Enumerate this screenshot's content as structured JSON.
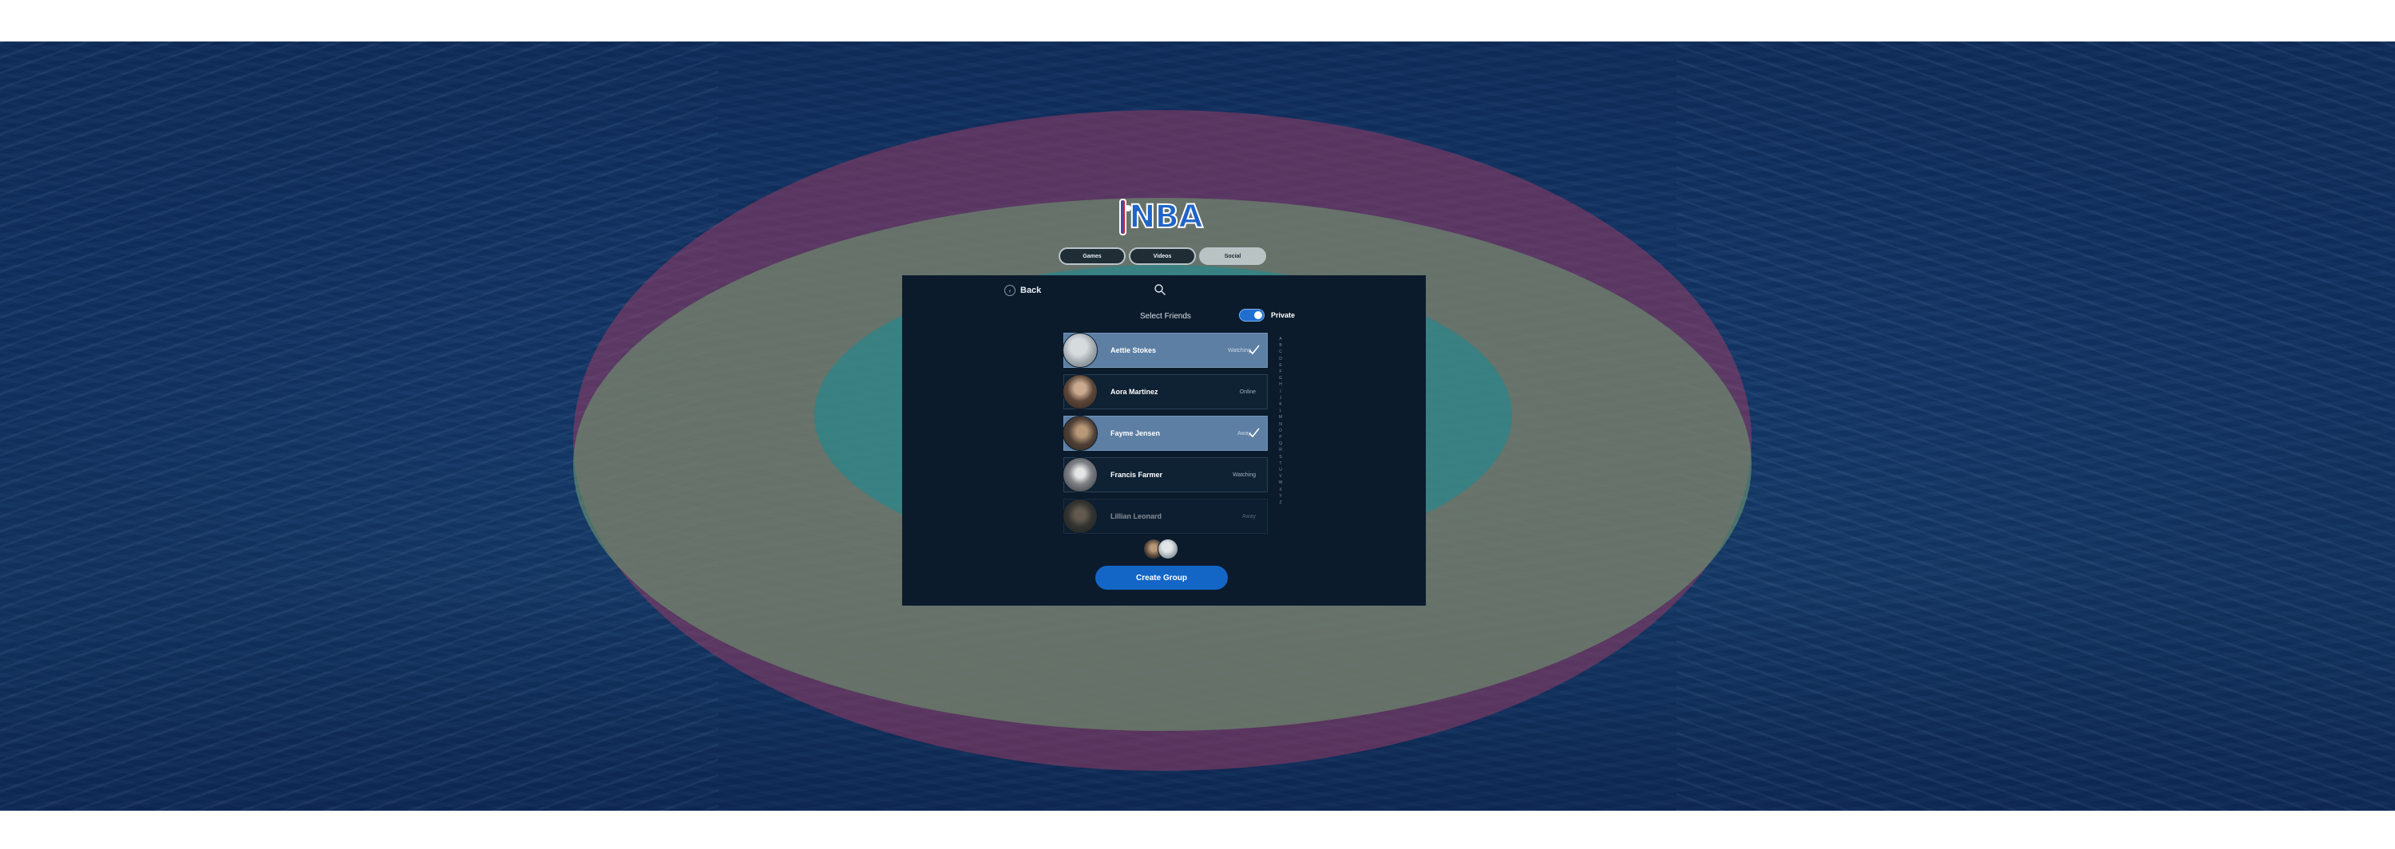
{
  "app": {
    "logo_text": "NBA"
  },
  "tabs": [
    {
      "label": "Games",
      "active": false
    },
    {
      "label": "Videos",
      "active": false
    },
    {
      "label": "Social",
      "active": true
    }
  ],
  "panel": {
    "back_label": "Back",
    "title": "Select Friends",
    "toggle": {
      "label": "Private",
      "on": true
    },
    "friends": [
      {
        "name": "Aettie Stokes",
        "status": "Watching",
        "selected": true,
        "avatar_color": "#a7b0b6"
      },
      {
        "name": "Aora Martinez",
        "status": "Online",
        "selected": false,
        "avatar_color": "#6b5a4e"
      },
      {
        "name": "Fayme Jensen",
        "status": "Away",
        "selected": true,
        "avatar_color": "#6a5d52"
      },
      {
        "name": "Francis Farmer",
        "status": "Watching",
        "selected": false,
        "avatar_color": "#8e9194"
      },
      {
        "name": "Lillian Leonard",
        "status": "Away",
        "selected": false,
        "avatar_color": "#7a6a52"
      }
    ],
    "alphabet": [
      "A",
      "B",
      "C",
      "D",
      "E",
      "F",
      "G",
      "H",
      "I",
      "J",
      "K",
      "L",
      "M",
      "N",
      "O",
      "P",
      "Q",
      "R",
      "S",
      "T",
      "U",
      "V",
      "W",
      "X",
      "Y",
      "Z"
    ],
    "create_button_label": "Create Group"
  },
  "colors": {
    "panel_bg": "#0b1b2c",
    "accent": "#1366c6",
    "selected_row": "#5d7fa4"
  }
}
